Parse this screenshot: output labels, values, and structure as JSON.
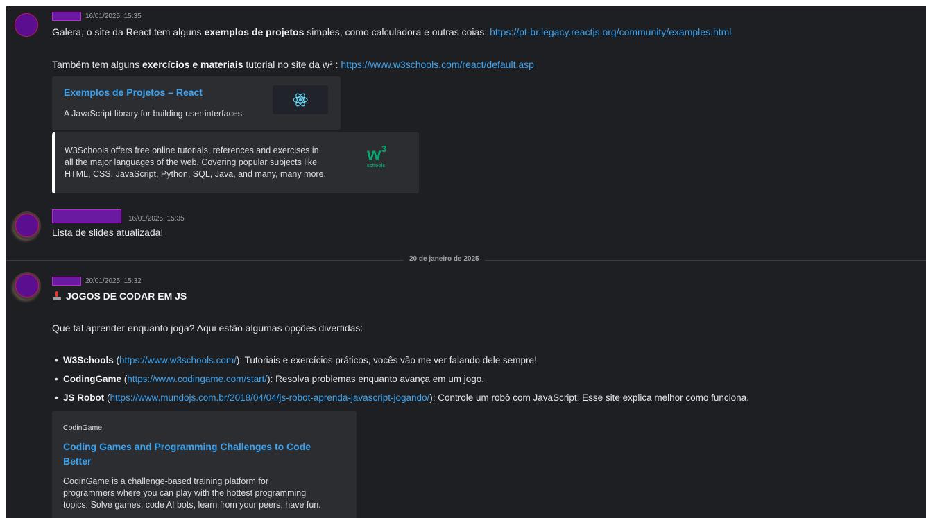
{
  "messages": [
    {
      "timestamp": "16/01/2025, 15:35",
      "line1": {
        "pre": "Galera, o site da React tem alguns ",
        "bold": "exemplos de projetos",
        "post": " simples, como calculadora e outras coias: ",
        "link": "https://pt-br.legacy.reactjs.org/community/examples.html"
      },
      "line2": {
        "pre": "Também tem alguns ",
        "bold": "exercícios e materiais",
        "post": " tutorial no site da w³ : ",
        "link": "https://www.w3schools.com/react/default.asp"
      },
      "embeds": [
        {
          "title": "Exemplos de Projetos – React",
          "description": "A JavaScript library for building user interfaces",
          "icon": "react-atom-icon"
        },
        {
          "description_lines": [
            "W3Schools offers free online tutorials, references and exercises in",
            "all the major languages of the web. Covering popular subjects like",
            "HTML, CSS, JavaScript, Python, SQL, Java, and many, many more."
          ],
          "logo_text": "w",
          "logo_sup": "3",
          "logo_sub": "schools",
          "logo_color": "#04aa6d"
        }
      ]
    },
    {
      "timestamp": "16/01/2025, 15:35",
      "text": "Lista de slides atualizada!"
    },
    {
      "date_divider": "20 de janeiro de 2025"
    },
    {
      "timestamp": "20/01/2025, 15:32",
      "heading": "JOGOS DE CODAR EM JS",
      "heading_icon": "joystick-icon",
      "intro": "Que tal aprender enquanto joga? Aqui estão algumas opções divertidas:",
      "bullets": [
        {
          "name": "W3Schools",
          "link": "https://www.w3schools.com/",
          "desc": "): Tutoriais e exercícios práticos, vocês vão me ver falando dele sempre!"
        },
        {
          "name": "CodingGame",
          "link": "https://www.codingame.com/start/",
          "desc": "): Resolva problemas enquanto avança em um jogo."
        },
        {
          "name": "JS Robot",
          "link": "https://www.mundojs.com.br/2018/04/04/js-robot-aprenda-javascript-jogando/",
          "desc": "): Controle um robô com JavaScript! Esse site explica melhor como funciona."
        }
      ],
      "embed": {
        "provider": "CodinGame",
        "title_lines": [
          "Coding Games and Programming Challenges to Code",
          "Better"
        ],
        "description_lines": [
          "CodinGame is a challenge-based training platform for",
          "programmers where you can play with the hottest programming",
          "topics. Solve games, code AI bots, learn from your peers, have fun."
        ]
      }
    }
  ],
  "colors": {
    "background": "#1e1f22",
    "embed_bg": "#2b2d31",
    "link": "#3ba3f0",
    "react_blue": "#61dafb"
  }
}
